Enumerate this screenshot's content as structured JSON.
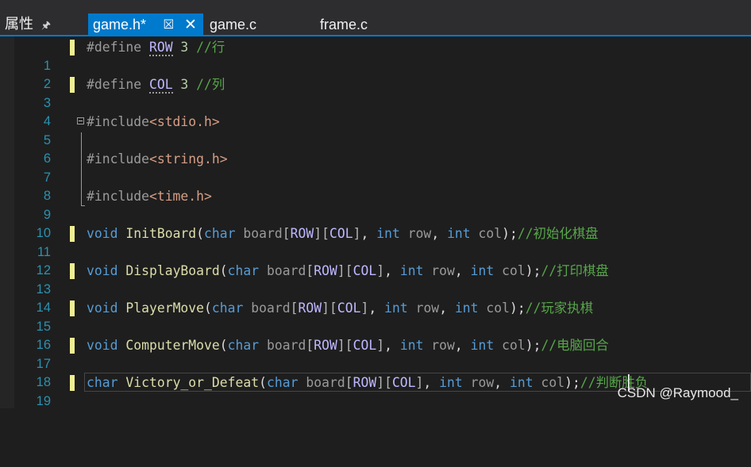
{
  "panel": {
    "title": "属性",
    "pin_icon": "pin-icon"
  },
  "tabs": [
    {
      "label": "game.h*",
      "active": true,
      "pin_icon": "pin-icon",
      "close_icon": "close-icon"
    },
    {
      "label": "game.c",
      "active": false
    },
    {
      "label": "frame.c",
      "active": false
    }
  ],
  "editor": {
    "line_numbers": [
      "1",
      "2",
      "3",
      "4",
      "5",
      "6",
      "7",
      "8",
      "9",
      "10",
      "11",
      "12",
      "13",
      "14",
      "15",
      "16",
      "17",
      "18",
      "19"
    ],
    "lines": {
      "l1": {
        "directive": "#define ",
        "macro": "ROW",
        "value": " 3 ",
        "comment": "//行"
      },
      "l3": {
        "directive": "#define ",
        "macro": "COL",
        "value": " 3 ",
        "comment": "//列"
      },
      "l5": {
        "directive": "#include",
        "header": "<stdio.h>"
      },
      "l7": {
        "directive": "#include",
        "header": "<string.h>"
      },
      "l9": {
        "directive": "#include",
        "header": "<time.h>"
      },
      "l11": {
        "ret": "void",
        "name": "InitBoard",
        "comment": "//初始化棋盘"
      },
      "l13": {
        "ret": "void",
        "name": "DisplayBoard",
        "comment": "//打印棋盘"
      },
      "l15": {
        "ret": "void",
        "name": "PlayerMove",
        "comment": "//玩家执棋"
      },
      "l17": {
        "ret": "void",
        "name": "ComputerMove",
        "comment": "//电脑回合"
      },
      "l19": {
        "ret": "char",
        "name": "Victory_or_Defeat",
        "comment": "//判断胜负"
      }
    },
    "tokens": {
      "open_paren": "(",
      "char_kw": "char",
      "board": " board",
      "lb": "[",
      "rb": "]",
      "row_macro": "ROW",
      "col_macro": "COL",
      "comma": ",",
      "int_kw": "int",
      "row_param": " row",
      "col_param": " col",
      "close": ");",
      "space": " "
    }
  },
  "watermark": "CSDN @Raymood_",
  "colors": {
    "accent": "#007acc",
    "background": "#1e1e1e",
    "change_marker": "#efef91"
  }
}
